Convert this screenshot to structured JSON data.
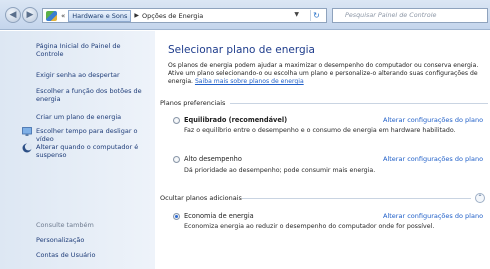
{
  "address_bar": {
    "crumb_highlighted": "Hardware e Sons",
    "crumb_current": "Opções de Energia",
    "search_placeholder": "Pesquisar Painel de Controle"
  },
  "sidebar": {
    "home": "Página Inicial do Painel de Controle",
    "links": [
      "Exigir senha ao despertar",
      "Escolher a função dos botões de energia",
      "Criar um plano de energia",
      "Escolher tempo para desligar o vídeo",
      "Alterar quando o computador é suspenso"
    ],
    "see_also": "Consulte também",
    "see_also_links": [
      "Personalização",
      "Contas de Usuário"
    ]
  },
  "main": {
    "title": "Selecionar plano de energia",
    "intro": "Os planos de energia podem ajudar a maximizar o desempenho do computador ou conserva energia. Ative um plano selecionando-o ou escolha um plano e personalize-o alterando suas configurações de energia.",
    "intro_link": "Saiba mais sobre planos de energia",
    "preferred_heading": "Planos preferenciais",
    "hidden_heading": "Ocultar planos adicionais",
    "change_link": "Alterar configurações do plano",
    "plans": [
      {
        "name": "Equilibrado (recomendável)",
        "desc": "Faz o equilíbrio entre o desempenho e o consumo de energia em hardware habilitado.",
        "selected": false
      },
      {
        "name": "Alto desempenho",
        "desc": "Dá prioridade ao desempenho; pode consumir mais energia.",
        "selected": false
      },
      {
        "name": "Economia de energia",
        "desc": "Economiza energia ao reduzir o desempenho do computador onde for possível.",
        "selected": true
      }
    ]
  }
}
